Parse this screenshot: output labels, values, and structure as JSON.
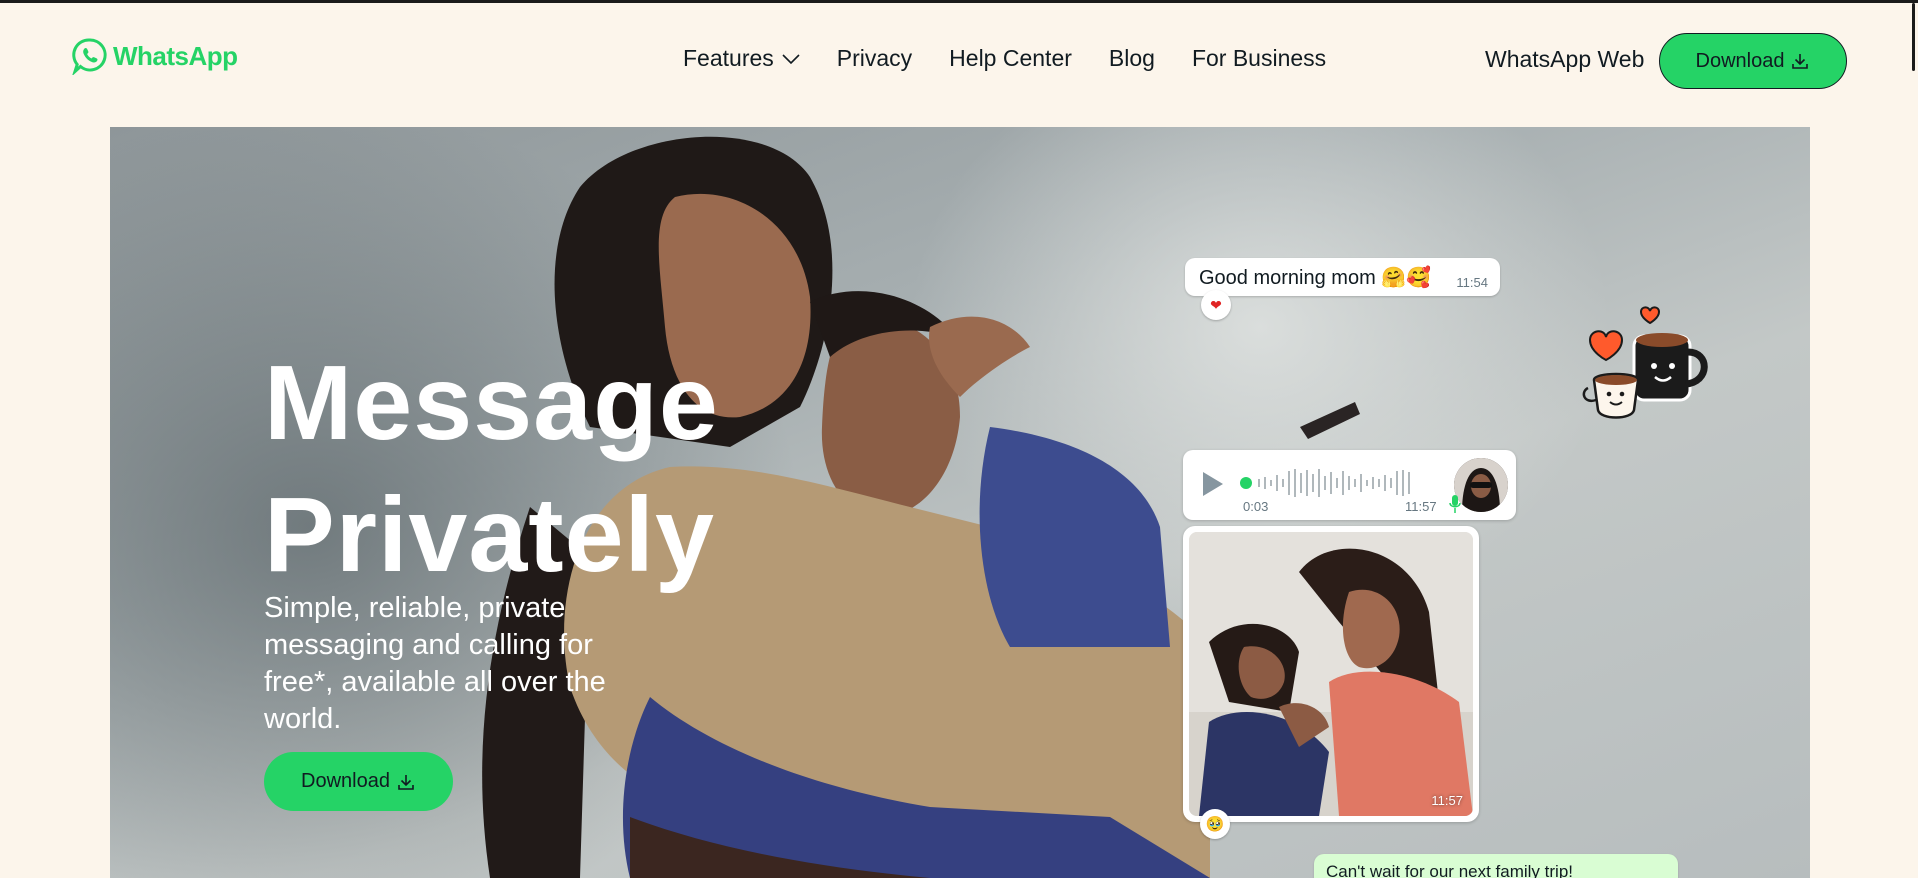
{
  "header": {
    "logo_text": "WhatsApp",
    "nav": [
      {
        "label": "Features",
        "has_dropdown": true
      },
      {
        "label": "Privacy"
      },
      {
        "label": "Help Center"
      },
      {
        "label": "Blog"
      },
      {
        "label": "For Business"
      }
    ],
    "web_link": "WhatsApp Web",
    "download_label": "Download"
  },
  "hero": {
    "headline_line1": "Message",
    "headline_line2": "Privately",
    "subtitle": "Simple, reliable, private messaging and calling for free*, available all over the world.",
    "download_label": "Download"
  },
  "chat": {
    "greeting": {
      "text": "Good morning mom 🤗🥰",
      "time": "11:54",
      "reaction": "❤"
    },
    "voice_note": {
      "elapsed": "0:03",
      "time": "11:57"
    },
    "photo": {
      "time": "11:57",
      "reaction": "🥹"
    },
    "trip": {
      "text": "Can't wait for our next family trip!"
    }
  },
  "colors": {
    "brand_green": "#25d366",
    "page_bg": "#fcf5eb",
    "outgoing_bubble": "#d9fdd3"
  }
}
